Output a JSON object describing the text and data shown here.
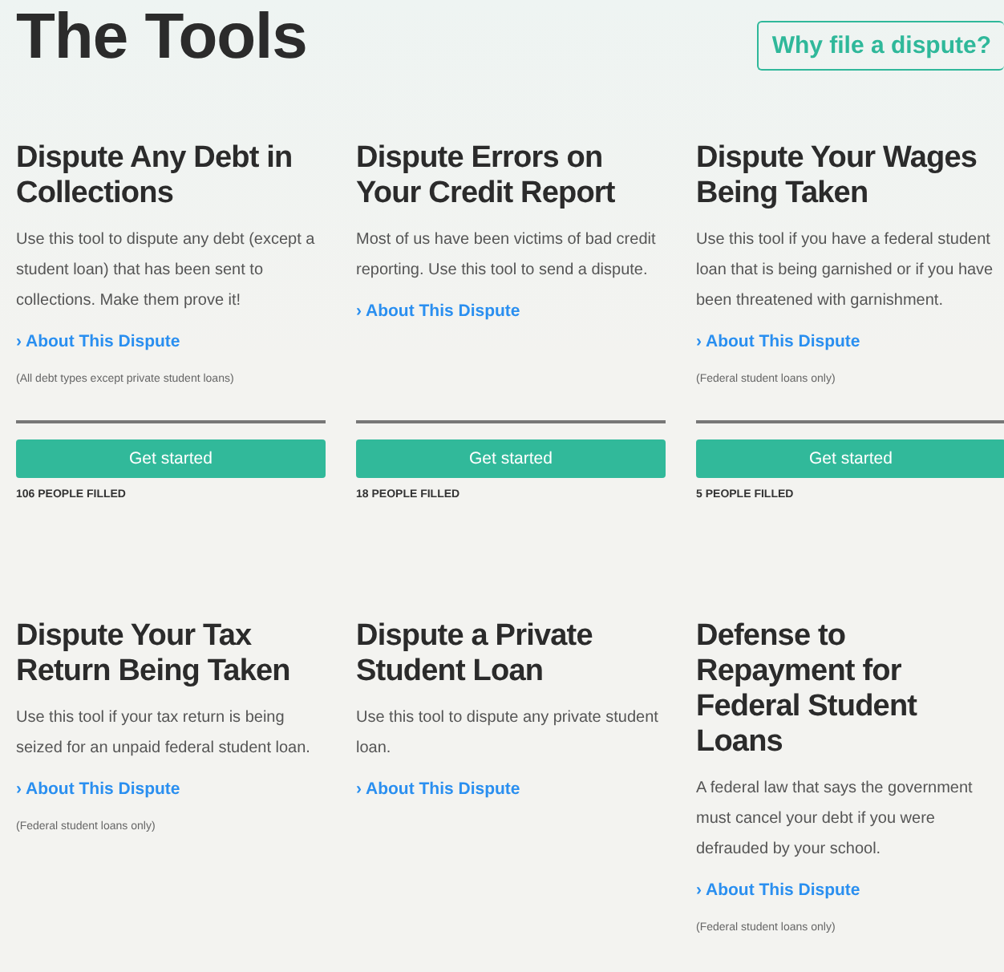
{
  "header": {
    "title": "The Tools",
    "button": "Why file a dispute?"
  },
  "tools": [
    {
      "title": "Dispute Any Debt in Collections",
      "description": "Use this tool to dispute any debt (except a student loan) that has been sent to collections. Make them prove it!",
      "link": "› About This Dispute",
      "note": "(All debt types except private student loans)",
      "button": "Get started",
      "count": "**106** PEOPLE FILLED"
    },
    {
      "title": "Dispute Errors on Your Credit Report",
      "description": "Most of us have been victims of bad credit reporting. Use this tool to send a dispute.",
      "link": "› About This Dispute",
      "button": "Get started",
      "count": "**18** PEOPLE FILLED"
    },
    {
      "title": "Dispute Your Wages Being Taken",
      "description": "Use this tool if you have a federal student loan that is being garnished or if you have been threatened with garnishment.",
      "link": "› About This Dispute",
      "note": "(Federal student loans only)",
      "button": "Get started",
      "count": "**5** PEOPLE FILLED"
    },
    {
      "title": "Dispute Your Tax Return Being Taken",
      "description": "Use this tool if your tax return is being seized for an unpaid federal student loan.",
      "link": "› About This Dispute",
      "note": "(Federal student loans only)"
    },
    {
      "title": "Dispute a Private Student Loan",
      "description": "Use this tool to dispute any private student loan.",
      "link": "› About This Dispute"
    },
    {
      "title": "Defense to Repayment for Federal Student Loans",
      "description": "A federal law that says the government must cancel your debt if you were defrauded by your school.",
      "link": "› About This Dispute",
      "note": "(Federal student loans only)"
    }
  ]
}
